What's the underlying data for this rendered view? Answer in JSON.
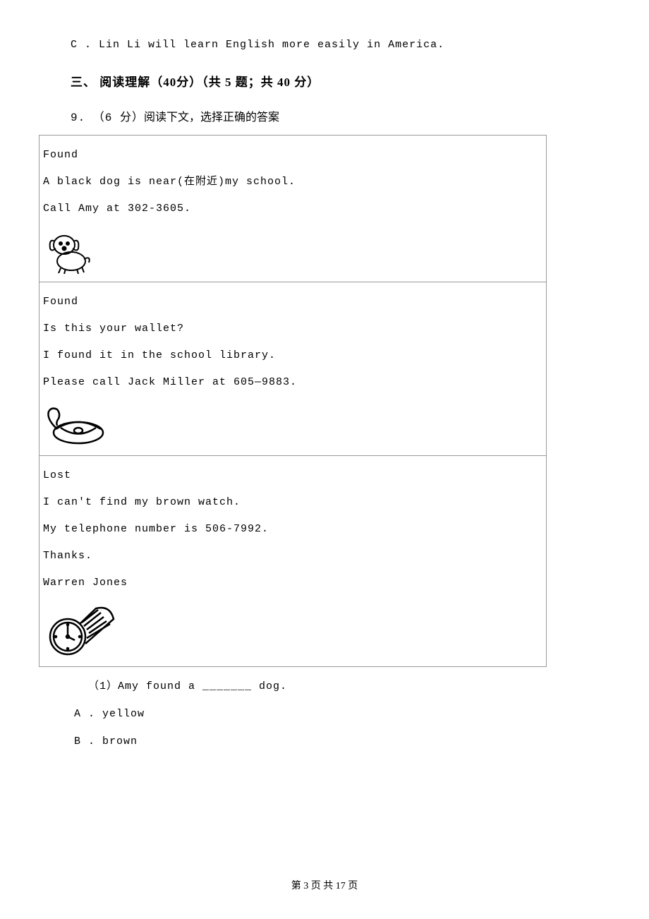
{
  "top_option": "C . Lin Li will learn English more easily in America.",
  "section_heading": "三、 阅读理解（40分）（共 5 题；共 40 分）",
  "question_intro_num": "9. （6 分）",
  "question_intro_text": "阅读下文，选择正确的答案",
  "cells": [
    {
      "title": "Found",
      "lines": [
        "A black dog is near(在附近)my school.",
        "Call Amy at 302-3605."
      ]
    },
    {
      "title": "Found",
      "lines": [
        "Is this your wallet?",
        "I found it in the school library.",
        "Please call Jack Miller at 605—9883."
      ]
    },
    {
      "title": "Lost",
      "lines": [
        "I can't find my brown watch.",
        "My telephone number is 506-7992.",
        "Thanks.",
        "Warren Jones"
      ]
    }
  ],
  "subq_label": "（1）Amy found a _______ dog.",
  "subq_options": {
    "a": "A . yellow",
    "b": "B . brown"
  },
  "footer": "第 3 页 共 17 页"
}
